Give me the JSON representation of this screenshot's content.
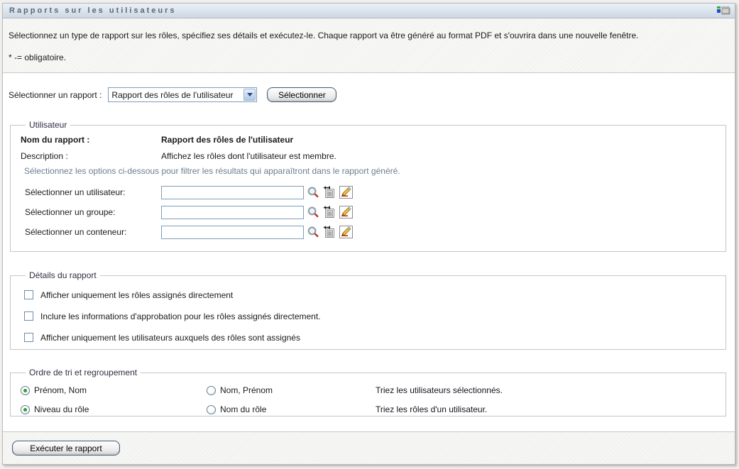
{
  "window": {
    "title": "Rapports sur les utilisateurs",
    "window_icon": "restore-portlet-icon"
  },
  "intro": {
    "text": "Sélectionnez un type de rapport sur les rôles, spécifiez ses détails et exécutez-le. Chaque rapport va être généré au format PDF et s'ouvrira dans une nouvelle fenêtre.",
    "required_note": "* -= obligatoire."
  },
  "report_select": {
    "label": "Sélectionner un rapport :",
    "selected": "Rapport des rôles de l'utilisateur",
    "button": "Sélectionner"
  },
  "user_section": {
    "legend": "Utilisateur",
    "report_name_label": "Nom du rapport :",
    "report_name_value": "Rapport des rôles de l'utilisateur",
    "description_label": "Description :",
    "description_value": "Affichez les rôles dont l'utilisateur est membre.",
    "filter_hint": "Sélectionnez les options ci-dessous pour filtrer les résultats qui apparaîtront dans le rapport généré.",
    "selectors": [
      {
        "label": "Sélectionner un utilisateur:",
        "value": ""
      },
      {
        "label": "Sélectionner un groupe:",
        "value": ""
      },
      {
        "label": "Sélectionner un conteneur:",
        "value": ""
      }
    ],
    "icon_names": [
      "search-icon",
      "history-icon",
      "reset-icon"
    ]
  },
  "details_section": {
    "legend": "Détails du rapport",
    "checkboxes": [
      {
        "label": "Afficher uniquement les rôles assignés directement",
        "checked": false
      },
      {
        "label": "Inclure les informations d'approbation pour les rôles assignés directement.",
        "checked": false
      },
      {
        "label": "Afficher uniquement les utilisateurs auxquels des rôles sont assignés",
        "checked": false
      }
    ]
  },
  "sort_section": {
    "legend": "Ordre de tri et regroupement",
    "rows": [
      {
        "option1": {
          "label": "Prénom, Nom",
          "selected": true
        },
        "option2": {
          "label": "Nom, Prénom",
          "selected": false
        },
        "hint": "Triez les utilisateurs sélectionnés."
      },
      {
        "option1": {
          "label": "Niveau du rôle",
          "selected": true
        },
        "option2": {
          "label": "Nom du rôle",
          "selected": false
        },
        "hint": "Triez les rôles d'un utilisateur."
      }
    ]
  },
  "footer": {
    "run_button": "Exécuter le rapport"
  },
  "colors": {
    "titlebar_gradient_top": "#eaf0f6",
    "titlebar_gradient_bottom": "#cdd8e4",
    "titlebar_text": "#5a6876",
    "input_border": "#7f9db9",
    "hint_text": "#6b7e90",
    "radio_selected_dot": "#2d9e2d",
    "search_handle_red": "#c23018",
    "pencil_yellow": "#f2c23a",
    "icon_green": "#2db52d",
    "icon_blue": "#2a46c8"
  }
}
